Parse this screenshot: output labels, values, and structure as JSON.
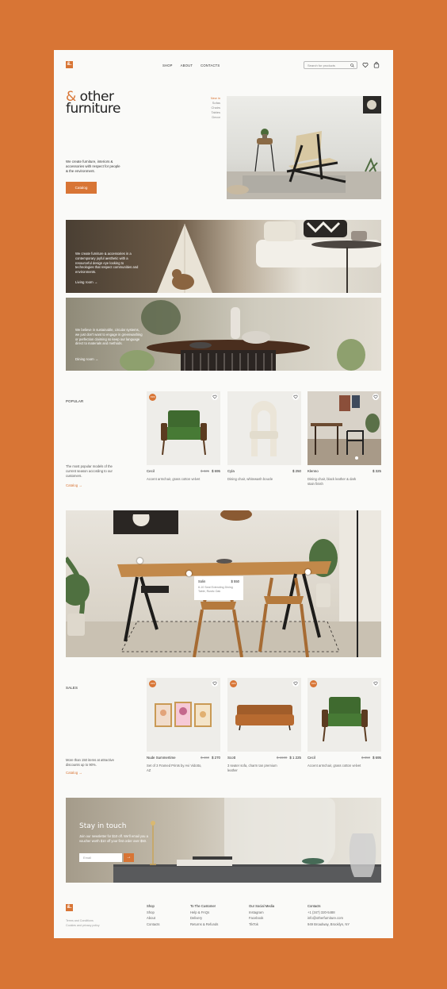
{
  "header": {
    "logo": "&.",
    "nav": [
      "SHOP",
      "ABOUT",
      "CONTACTS"
    ],
    "search_placeholder": "Search for products"
  },
  "hero": {
    "title_amp": "&",
    "title_line1": " other",
    "title_line2": "furniture",
    "categories": [
      "New in",
      "Sofas",
      "Chairs",
      "Tables",
      "Decor"
    ],
    "description": "We create furniture, interiors & accessories with respect for people & the environment.",
    "button": "Catalog"
  },
  "banners": [
    {
      "text": "We create furniture & accessories in a contemporary joyful aesthetic with a resourceful design eye looking to technologies that respect communities and environments.",
      "link": "Living room →"
    },
    {
      "text": "We believe in sustainable, circular systems, we just don't want to engage in greenwashing or perfection claiming so keep our language direct to materials and methods.",
      "link": "Dining room →"
    }
  ],
  "popular": {
    "label": "POPULAR",
    "description": "The most popular models of the current season according to our customers.",
    "link": "Catalog →",
    "products": [
      {
        "badge": "-50%",
        "name": "Cecil",
        "old_price": "$ 325",
        "price": "$ 695",
        "desc": "Accent armchair, grass cotton velvet"
      },
      {
        "badge": "",
        "name": "Cyla",
        "old_price": "",
        "price": "$ 250",
        "desc": "Dining chair, whitewash boucle"
      },
      {
        "badge": "",
        "name": "Klenno",
        "old_price": "",
        "price": "$ 325",
        "desc": "Dining chair, black leather & dark stain finish"
      }
    ]
  },
  "tooltip": {
    "name": "Solin",
    "price": "$ 550",
    "desc": "8-10 Seat Extending Dining Table, Rustic Oak"
  },
  "sales": {
    "label": "SALES",
    "description": "More than 150 items at attractive discounts up to 90%.",
    "link": "Catalog →",
    "products": [
      {
        "badge": "-90%",
        "name": "Nude Summertime",
        "old_price": "$ 460",
        "price": "$ 270",
        "desc": "Set of 3 Framed Prints by Avi Vidotto, AZ"
      },
      {
        "badge": "-30%",
        "name": "Scott",
        "old_price": "$ 1500",
        "price": "$ 1 225",
        "desc": "3 seater sofa, charm tan premium leather"
      },
      {
        "badge": "-50%",
        "name": "Cecil",
        "old_price": "$ 350",
        "price": "$ 695",
        "desc": "Accent armchair, grass cotton velvet"
      }
    ]
  },
  "newsletter": {
    "title": "Stay in touch",
    "description": "Join our newsletter for $10 off. We'll email you a voucher worth $10 off your first order over $50.",
    "placeholder": "Email",
    "button": "→"
  },
  "footer": {
    "logo": "&.",
    "legal": [
      "Terms and Conditions",
      "Cookies and privacy policy"
    ],
    "columns": [
      {
        "title": "Shop",
        "items": [
          "Shop",
          "About",
          "Contacts"
        ]
      },
      {
        "title": "To The Customer",
        "items": [
          "Help & FAQs",
          "Delivery",
          "Returns & Refunds"
        ]
      },
      {
        "title": "Our Social Media",
        "items": [
          "Instagram",
          "Facebook",
          "TikTok"
        ]
      },
      {
        "title": "Contacts",
        "items": [
          "+1 (347) 320-5488",
          "info@otherfurniture.com",
          "949 Broadway, Brooklyn, NY"
        ]
      }
    ]
  },
  "colors": {
    "accent": "#d87535",
    "background": "#d87535",
    "page": "#fafaf8"
  }
}
